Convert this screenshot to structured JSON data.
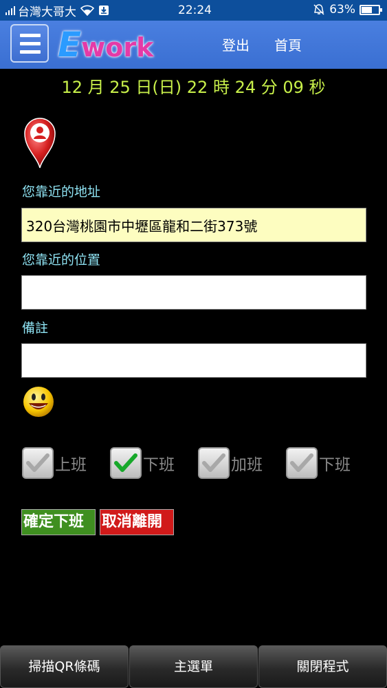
{
  "status_bar": {
    "carrier": "台灣大哥大",
    "time": "22:24",
    "battery_percent": "63%",
    "battery_level": 0.63,
    "icons": [
      "signal-icon",
      "wifi-icon",
      "download-icon",
      "mute-bell-icon",
      "battery-icon"
    ]
  },
  "header": {
    "logo_e": "E",
    "logo_work": "work",
    "logout": "登出",
    "home": "首頁"
  },
  "datetime": "12 月 25 日(日) 22 時 24 分 09 秒",
  "form": {
    "address_label": "您靠近的地址",
    "address_value": "320台灣桃園市中壢區龍和二街373號",
    "location_label": "您靠近的位置",
    "location_value": "",
    "note_label": "備註",
    "note_value": ""
  },
  "checkboxes": [
    {
      "label": "上班",
      "checked": false
    },
    {
      "label": "下班",
      "checked": true
    },
    {
      "label": "加班",
      "checked": false
    },
    {
      "label": "下班",
      "checked": false
    }
  ],
  "actions": {
    "confirm": "確定下班",
    "cancel": "取消離開"
  },
  "bottom_bar": {
    "scan": "掃描QR條碼",
    "main_menu": "主選單",
    "close_app": "關閉程式"
  },
  "colors": {
    "header_blue": "#3a6fd2",
    "datetime_green": "#c8f04a",
    "label_cyan": "#8fe3f3",
    "confirm_green": "#3f8f20",
    "cancel_red": "#d11a1a",
    "address_bg": "#fdfdc0"
  }
}
